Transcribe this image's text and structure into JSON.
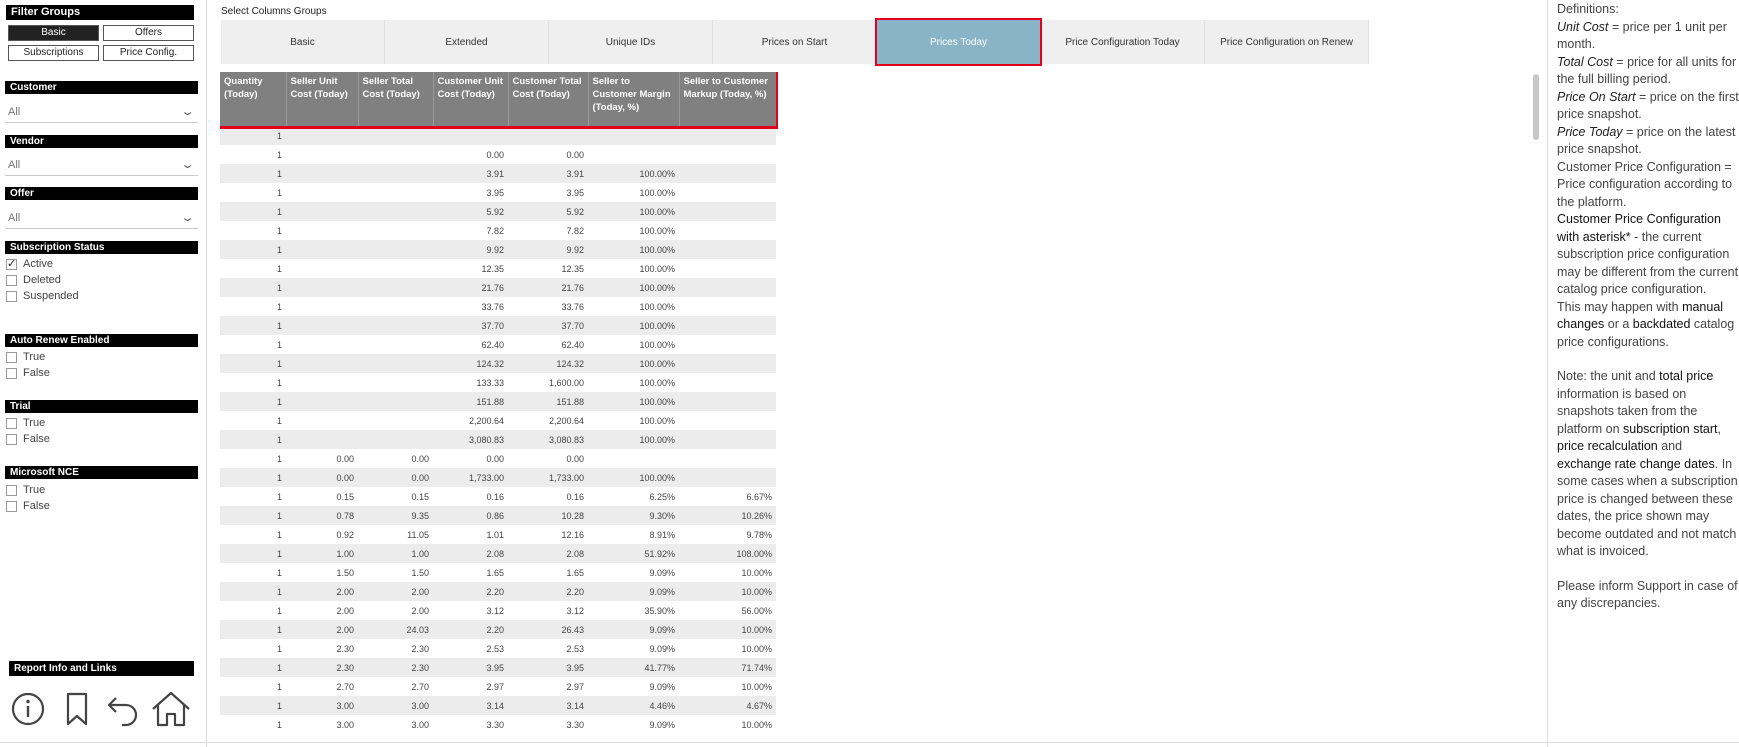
{
  "filter_panel": {
    "title": "Filter Groups",
    "buttons": [
      {
        "label": "Basic",
        "active": true
      },
      {
        "label": "Offers",
        "active": false
      },
      {
        "label": "Subscriptions",
        "active": false
      },
      {
        "label": "Price Config.",
        "active": false
      }
    ],
    "customer": {
      "label": "Customer",
      "value": "All"
    },
    "vendor": {
      "label": "Vendor",
      "value": "All"
    },
    "offer": {
      "label": "Offer",
      "value": "All"
    },
    "subscription_status": {
      "label": "Subscription Status",
      "options": [
        {
          "label": "Active",
          "checked": true
        },
        {
          "label": "Deleted",
          "checked": false
        },
        {
          "label": "Suspended",
          "checked": false
        }
      ]
    },
    "auto_renew": {
      "label": "Auto Renew Enabled",
      "options": [
        {
          "label": "True",
          "checked": false
        },
        {
          "label": "False",
          "checked": false
        }
      ]
    },
    "trial": {
      "label": "Trial",
      "options": [
        {
          "label": "True",
          "checked": false
        },
        {
          "label": "False",
          "checked": false
        }
      ]
    },
    "microsoft_nce": {
      "label": "Microsoft NCE",
      "options": [
        {
          "label": "True",
          "checked": false
        },
        {
          "label": "False",
          "checked": false
        }
      ]
    },
    "report_info": {
      "label": "Report Info and Links"
    },
    "icons": [
      "info-icon",
      "bookmark-icon",
      "back-arrow-icon",
      "home-icon"
    ]
  },
  "main": {
    "select_label": "Select Columns Groups",
    "tabs": [
      {
        "label": "Basic",
        "active": false
      },
      {
        "label": "Extended",
        "active": false
      },
      {
        "label": "Unique IDs",
        "active": false
      },
      {
        "label": "Prices on Start",
        "active": false
      },
      {
        "label": "Prices Today",
        "active": true
      },
      {
        "label": "Price Configuration Today",
        "active": false
      },
      {
        "label": "Price Configuration on Renew",
        "active": false
      }
    ],
    "table": {
      "columns": [
        "Quantity (Today)",
        "Seller Unit Cost (Today)",
        "Seller Total Cost (Today)",
        "Customer Unit Cost (Today)",
        "Customer Total Cost (Today)",
        "Seller to Customer Margin (Today, %)",
        "Seller to Customer Markup (Today, %)"
      ],
      "rows": [
        [
          "1",
          "",
          "",
          "",
          "",
          "",
          ""
        ],
        [
          "1",
          "",
          "",
          "0.00",
          "0.00",
          "",
          ""
        ],
        [
          "1",
          "",
          "",
          "3.91",
          "3.91",
          "100.00%",
          ""
        ],
        [
          "1",
          "",
          "",
          "3.95",
          "3.95",
          "100.00%",
          ""
        ],
        [
          "1",
          "",
          "",
          "5.92",
          "5.92",
          "100.00%",
          ""
        ],
        [
          "1",
          "",
          "",
          "7.82",
          "7.82",
          "100.00%",
          ""
        ],
        [
          "1",
          "",
          "",
          "9.92",
          "9.92",
          "100.00%",
          ""
        ],
        [
          "1",
          "",
          "",
          "12.35",
          "12.35",
          "100.00%",
          ""
        ],
        [
          "1",
          "",
          "",
          "21.76",
          "21.76",
          "100.00%",
          ""
        ],
        [
          "1",
          "",
          "",
          "33.76",
          "33.76",
          "100.00%",
          ""
        ],
        [
          "1",
          "",
          "",
          "37.70",
          "37.70",
          "100.00%",
          ""
        ],
        [
          "1",
          "",
          "",
          "62.40",
          "62.40",
          "100.00%",
          ""
        ],
        [
          "1",
          "",
          "",
          "124.32",
          "124.32",
          "100.00%",
          ""
        ],
        [
          "1",
          "",
          "",
          "133.33",
          "1,600.00",
          "100.00%",
          ""
        ],
        [
          "1",
          "",
          "",
          "151.88",
          "151.88",
          "100.00%",
          ""
        ],
        [
          "1",
          "",
          "",
          "2,200.64",
          "2,200.64",
          "100.00%",
          ""
        ],
        [
          "1",
          "",
          "",
          "3,080.83",
          "3,080.83",
          "100.00%",
          ""
        ],
        [
          "1",
          "0.00",
          "0.00",
          "0.00",
          "0.00",
          "",
          ""
        ],
        [
          "1",
          "0.00",
          "0.00",
          "1,733.00",
          "1,733.00",
          "100.00%",
          ""
        ],
        [
          "1",
          "0.15",
          "0.15",
          "0.16",
          "0.16",
          "6.25%",
          "6.67%"
        ],
        [
          "1",
          "0.78",
          "9.35",
          "0.86",
          "10.28",
          "9.30%",
          "10.26%"
        ],
        [
          "1",
          "0.92",
          "11.05",
          "1.01",
          "12.16",
          "8.91%",
          "9.78%"
        ],
        [
          "1",
          "1.00",
          "1.00",
          "2.08",
          "2.08",
          "51.92%",
          "108.00%"
        ],
        [
          "1",
          "1.50",
          "1.50",
          "1.65",
          "1.65",
          "9.09%",
          "10.00%"
        ],
        [
          "1",
          "2.00",
          "2.00",
          "2.20",
          "2.20",
          "9.09%",
          "10.00%"
        ],
        [
          "1",
          "2.00",
          "2.00",
          "3.12",
          "3.12",
          "35.90%",
          "56.00%"
        ],
        [
          "1",
          "2.00",
          "24.03",
          "2.20",
          "26.43",
          "9.09%",
          "10.00%"
        ],
        [
          "1",
          "2.30",
          "2.30",
          "2.53",
          "2.53",
          "9.09%",
          "10.00%"
        ],
        [
          "1",
          "2.30",
          "2.30",
          "3.95",
          "3.95",
          "41.77%",
          "71.74%"
        ],
        [
          "1",
          "2.70",
          "2.70",
          "2.97",
          "2.97",
          "9.09%",
          "10.00%"
        ],
        [
          "1",
          "3.00",
          "3.00",
          "3.14",
          "3.14",
          "4.46%",
          "4.67%"
        ],
        [
          "1",
          "3.00",
          "3.00",
          "3.30",
          "3.30",
          "9.09%",
          "10.00%"
        ]
      ]
    }
  },
  "definitions": {
    "title": "Definitions:",
    "unit_cost_term": "Unit Cost",
    "unit_cost_text": " = price per 1 unit per month.",
    "total_cost_term": "Total Cost",
    "total_cost_text": " = price for all units for the full billing period.",
    "price_on_start_term": "Price On Start",
    "price_on_start_text": " = price on the first price snapshot.",
    "price_today_term": "Price Today",
    "price_today_text": " = price on the latest price snapshot.",
    "customer_price_config": "Customer Price Configuration = Price configuration according to the platform.",
    "asterisk_lead": "Customer Price Configuration with asterisk*",
    "asterisk_text": " - the current subscription price configuration may be different from the current catalog price configuration.",
    "may_happen_lead": "This may happen with ",
    "manual_changes": "manual changes",
    "or_a": " or a ",
    "backdated": "backdated",
    "catalog_tail": " catalog price configurations.",
    "note_lead": "Note: the unit and ",
    "total_price": "total price",
    "note_mid": " information is based on snapshots taken from the platform on ",
    "subscription_start": "subscription start",
    "comma": ", ",
    "price_recalc": "price recalculation",
    "and": " and ",
    "exchange_rate": "exchange rate change dates",
    "note_tail": ". In some cases when a subscription price is changed between these dates, the price shown may become outdated and not match what is invoiced.",
    "support": "Please inform Support in case of any discrepancies."
  }
}
